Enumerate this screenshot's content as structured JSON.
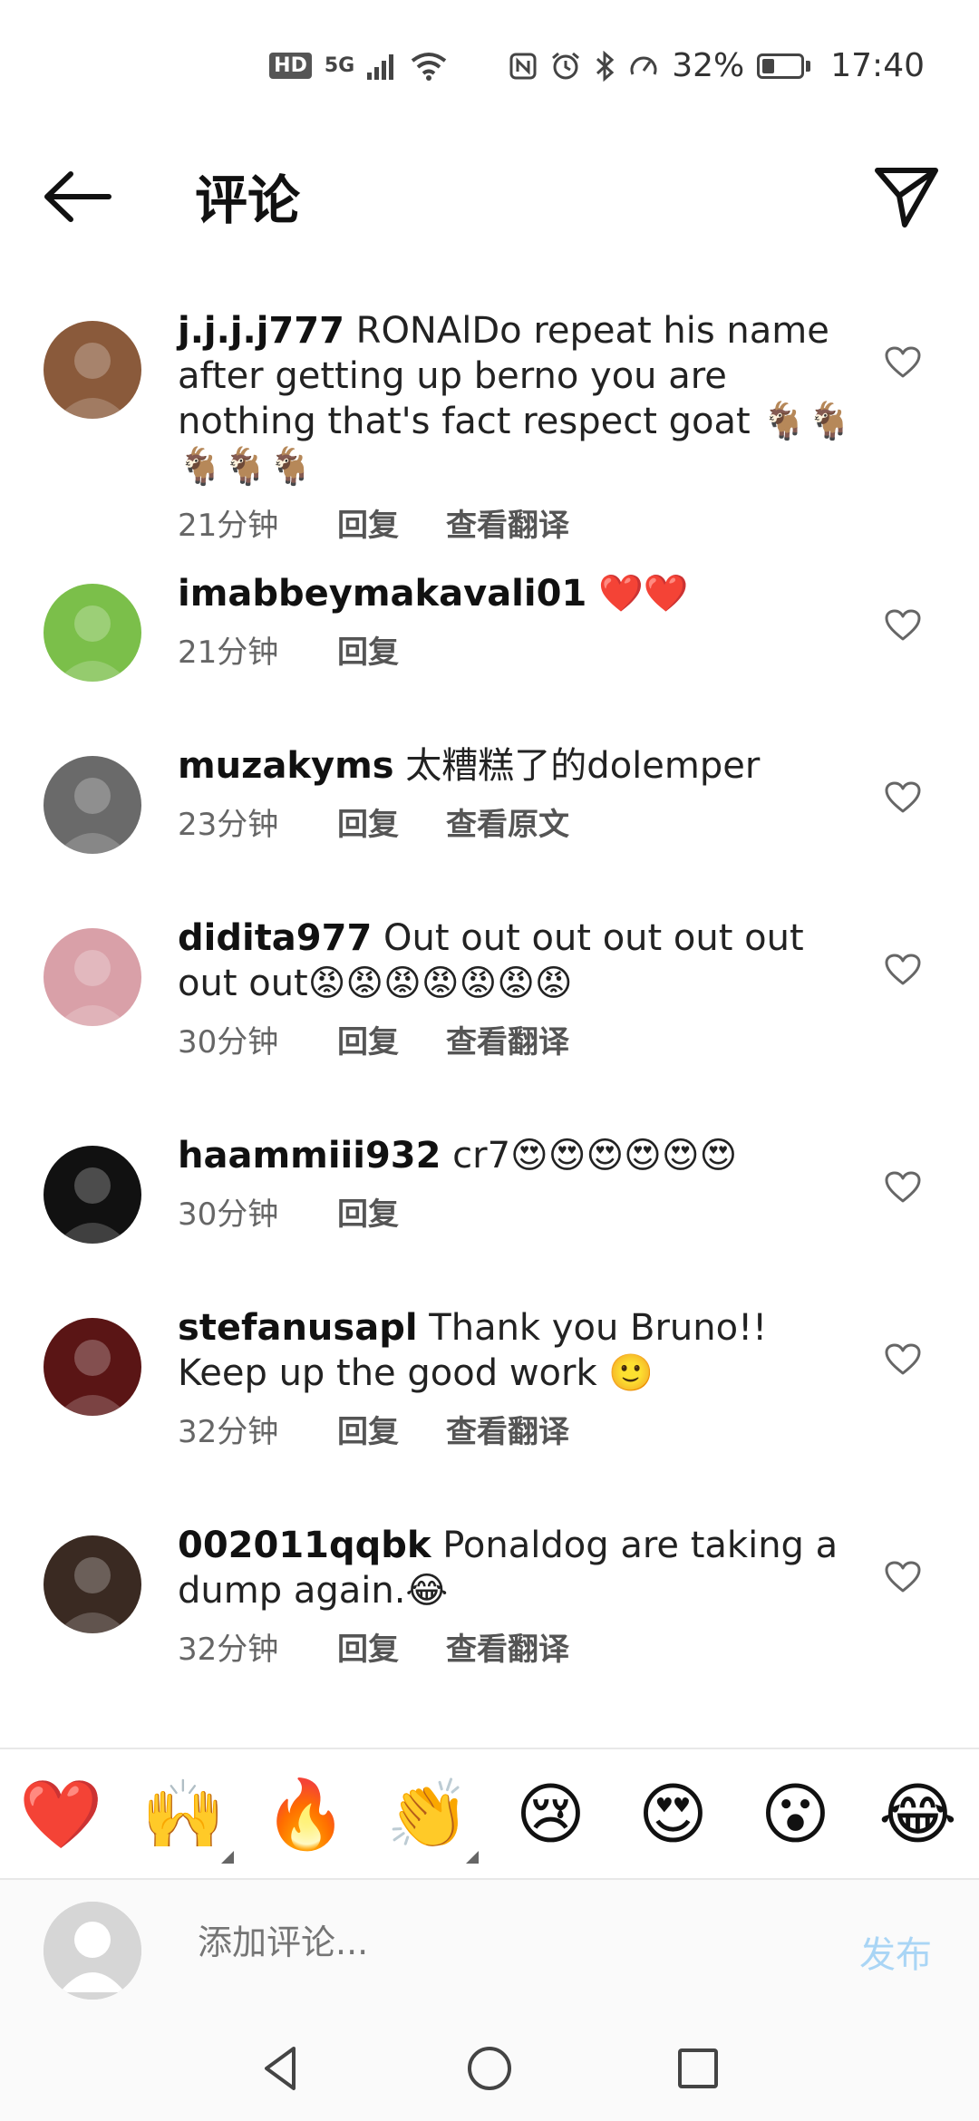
{
  "status_bar": {
    "hd": "HD",
    "network": "5G",
    "battery": "32%",
    "battery_level": 0.32,
    "time": "17:40"
  },
  "header": {
    "title": "评论"
  },
  "comments": [
    {
      "username": "j.j.j.j777",
      "text": " RONAlDo repeat his name after getting up berno you are nothing that's fact respect goat 🐐🐐🐐🐐🐐",
      "time": "21分钟",
      "reply": "回复",
      "translate": "查看翻译",
      "avatar_color": "#8a5a3b"
    },
    {
      "username": "imabbeymakavali01",
      "text": " ❤️❤️",
      "time": "21分钟",
      "reply": "回复",
      "translate": "",
      "avatar_color": "#7bbf4a"
    },
    {
      "username": "muzakyms",
      "text": " 太糟糕了的dolemper",
      "time": "23分钟",
      "reply": "回复",
      "translate": "查看原文",
      "avatar_color": "#6a6a6a"
    },
    {
      "username": "didita977",
      "text": " Out out out out out out out out😡😡😡😡😡😡😡",
      "time": "30分钟",
      "reply": "回复",
      "translate": "查看翻译",
      "avatar_color": "#d9a0a8"
    },
    {
      "username": "haammiii932",
      "text": " cr7😍😍😍😍😍😍",
      "time": "30分钟",
      "reply": "回复",
      "translate": "",
      "avatar_color": "#111111"
    },
    {
      "username": "stefanusapl",
      "text": " Thank you Bruno!! Keep up the good work 🙂",
      "time": "32分钟",
      "reply": "回复",
      "translate": "查看翻译",
      "avatar_color": "#5a1515"
    },
    {
      "username": "002011qqbk",
      "text": " Ponaldog are taking a dump again.😂",
      "time": "32分钟",
      "reply": "回复",
      "translate": "查看翻译",
      "avatar_color": "#3a2a22"
    }
  ],
  "reactions": [
    "❤️",
    "🙌",
    "🔥",
    "👏",
    "😢",
    "😍",
    "😮",
    "😂"
  ],
  "composer": {
    "placeholder": "添加评论...",
    "publish_label": "发布"
  },
  "icons": {
    "back": "arrow-left-icon",
    "send": "paper-plane-icon",
    "like": "heart-outline-icon"
  },
  "colors": {
    "publish_disabled": "#a9d5f5"
  }
}
